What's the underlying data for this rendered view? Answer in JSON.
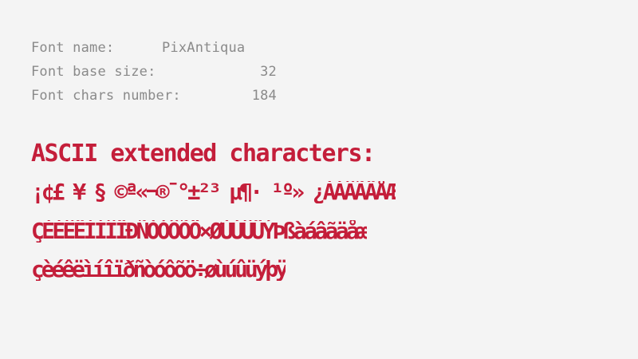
{
  "info": {
    "font_name_label": "Font name:",
    "font_name_value": "PixAntiqua",
    "base_size_label": "Font base size:",
    "base_size_value": "32",
    "chars_number_label": "Font chars number:",
    "chars_number_value": "184"
  },
  "sample": {
    "heading": "ASCII extended characters:",
    "line1": "¡¢£ ¥ § ©ª«¬®¯°±²³ µ¶· ¹º»  ¿ÀÁÂÃÄÅÆ",
    "line2": "ÇÈÉÊËÌÍÎÏÐÑÒÓÔÕÖ×ØÙÚÛÜÝÞßàáâãäåæ",
    "line3": "çèéêëìíîïðñòóôõö÷øùúûüýþÿ"
  },
  "colors": {
    "background": "#f4f4f4",
    "label_gray": "#8a8a8a",
    "glyph_red": "#c41e3a"
  }
}
